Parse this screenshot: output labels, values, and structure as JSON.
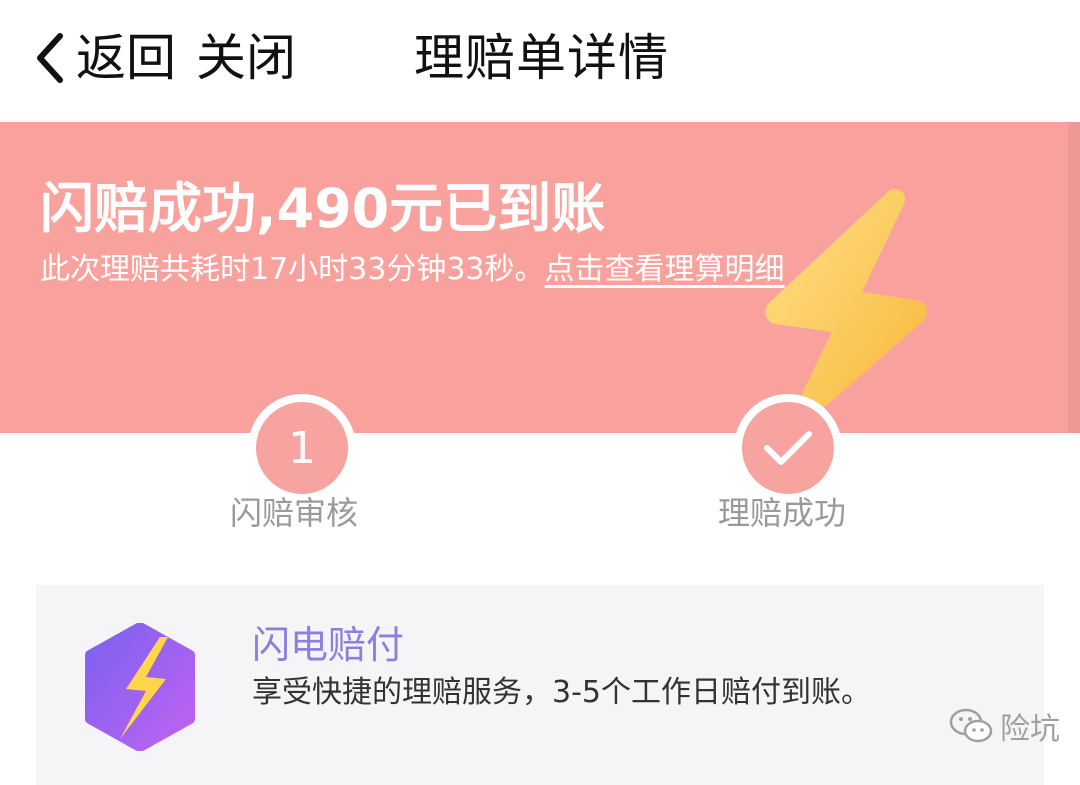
{
  "nav": {
    "back_label": "返回",
    "close_label": "关闭",
    "title": "理赔单详情"
  },
  "banner": {
    "title": "闪赔成功,490元已到账",
    "desc_text": "此次理赔共耗时17小时33分钟33秒。",
    "detail_link": "点击查看理算明细",
    "color": "#f9a19d"
  },
  "steps": [
    {
      "number": "1",
      "label": "闪赔审核"
    },
    {
      "icon": "check-icon",
      "label": "理赔成功"
    }
  ],
  "card": {
    "title": "闪电赔付",
    "desc": "享受快捷的理赔服务，3-5个工作日赔付到账。",
    "icon": "lightning-icon",
    "title_color": "#8e7ee0"
  },
  "watermark": {
    "text": "险坑",
    "icon": "wechat-icon"
  }
}
